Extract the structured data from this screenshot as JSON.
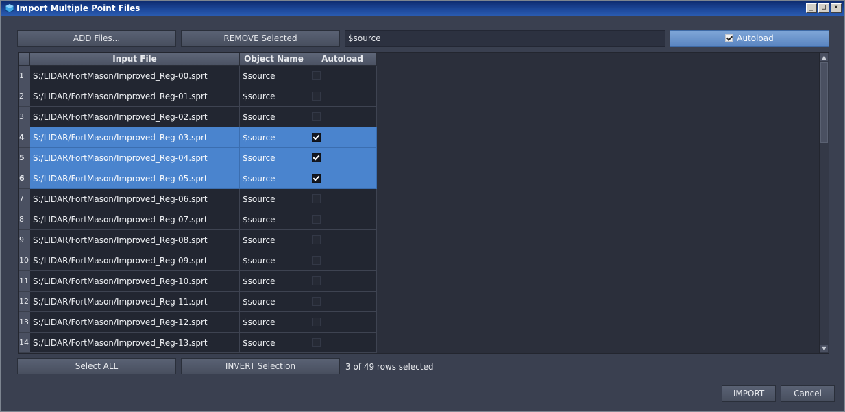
{
  "window": {
    "title": "Import Multiple Point Files"
  },
  "toolbar": {
    "add_label": "ADD Files...",
    "remove_label": "REMOVE Selected",
    "object_name_value": "$source",
    "autoload_label": "Autoload"
  },
  "table": {
    "columns": [
      "Input File",
      "Object Name",
      "Autoload"
    ],
    "rows": [
      {
        "num": "1",
        "file": "S:/LIDAR/FortMason/Improved_Reg-00.sprt",
        "object": "$source",
        "autoload": false,
        "selected": false
      },
      {
        "num": "2",
        "file": "S:/LIDAR/FortMason/Improved_Reg-01.sprt",
        "object": "$source",
        "autoload": false,
        "selected": false
      },
      {
        "num": "3",
        "file": "S:/LIDAR/FortMason/Improved_Reg-02.sprt",
        "object": "$source",
        "autoload": false,
        "selected": false
      },
      {
        "num": "4",
        "file": "S:/LIDAR/FortMason/Improved_Reg-03.sprt",
        "object": "$source",
        "autoload": true,
        "selected": true
      },
      {
        "num": "5",
        "file": "S:/LIDAR/FortMason/Improved_Reg-04.sprt",
        "object": "$source",
        "autoload": true,
        "selected": true
      },
      {
        "num": "6",
        "file": "S:/LIDAR/FortMason/Improved_Reg-05.sprt",
        "object": "$source",
        "autoload": true,
        "selected": true
      },
      {
        "num": "7",
        "file": "S:/LIDAR/FortMason/Improved_Reg-06.sprt",
        "object": "$source",
        "autoload": false,
        "selected": false
      },
      {
        "num": "8",
        "file": "S:/LIDAR/FortMason/Improved_Reg-07.sprt",
        "object": "$source",
        "autoload": false,
        "selected": false
      },
      {
        "num": "9",
        "file": "S:/LIDAR/FortMason/Improved_Reg-08.sprt",
        "object": "$source",
        "autoload": false,
        "selected": false
      },
      {
        "num": "10",
        "file": "S:/LIDAR/FortMason/Improved_Reg-09.sprt",
        "object": "$source",
        "autoload": false,
        "selected": false
      },
      {
        "num": "11",
        "file": "S:/LIDAR/FortMason/Improved_Reg-10.sprt",
        "object": "$source",
        "autoload": false,
        "selected": false
      },
      {
        "num": "12",
        "file": "S:/LIDAR/FortMason/Improved_Reg-11.sprt",
        "object": "$source",
        "autoload": false,
        "selected": false
      },
      {
        "num": "13",
        "file": "S:/LIDAR/FortMason/Improved_Reg-12.sprt",
        "object": "$source",
        "autoload": false,
        "selected": false
      },
      {
        "num": "14",
        "file": "S:/LIDAR/FortMason/Improved_Reg-13.sprt",
        "object": "$source",
        "autoload": false,
        "selected": false
      }
    ]
  },
  "footer": {
    "select_all_label": "Select ALL",
    "invert_label": "INVERT Selection",
    "status": "3 of 49 rows selected",
    "import_label": "IMPORT",
    "cancel_label": "Cancel"
  },
  "colors": {
    "selection": "#4a84ce",
    "active_button": "#6f97cd",
    "background": "#3a4050",
    "cell": "#222631"
  }
}
